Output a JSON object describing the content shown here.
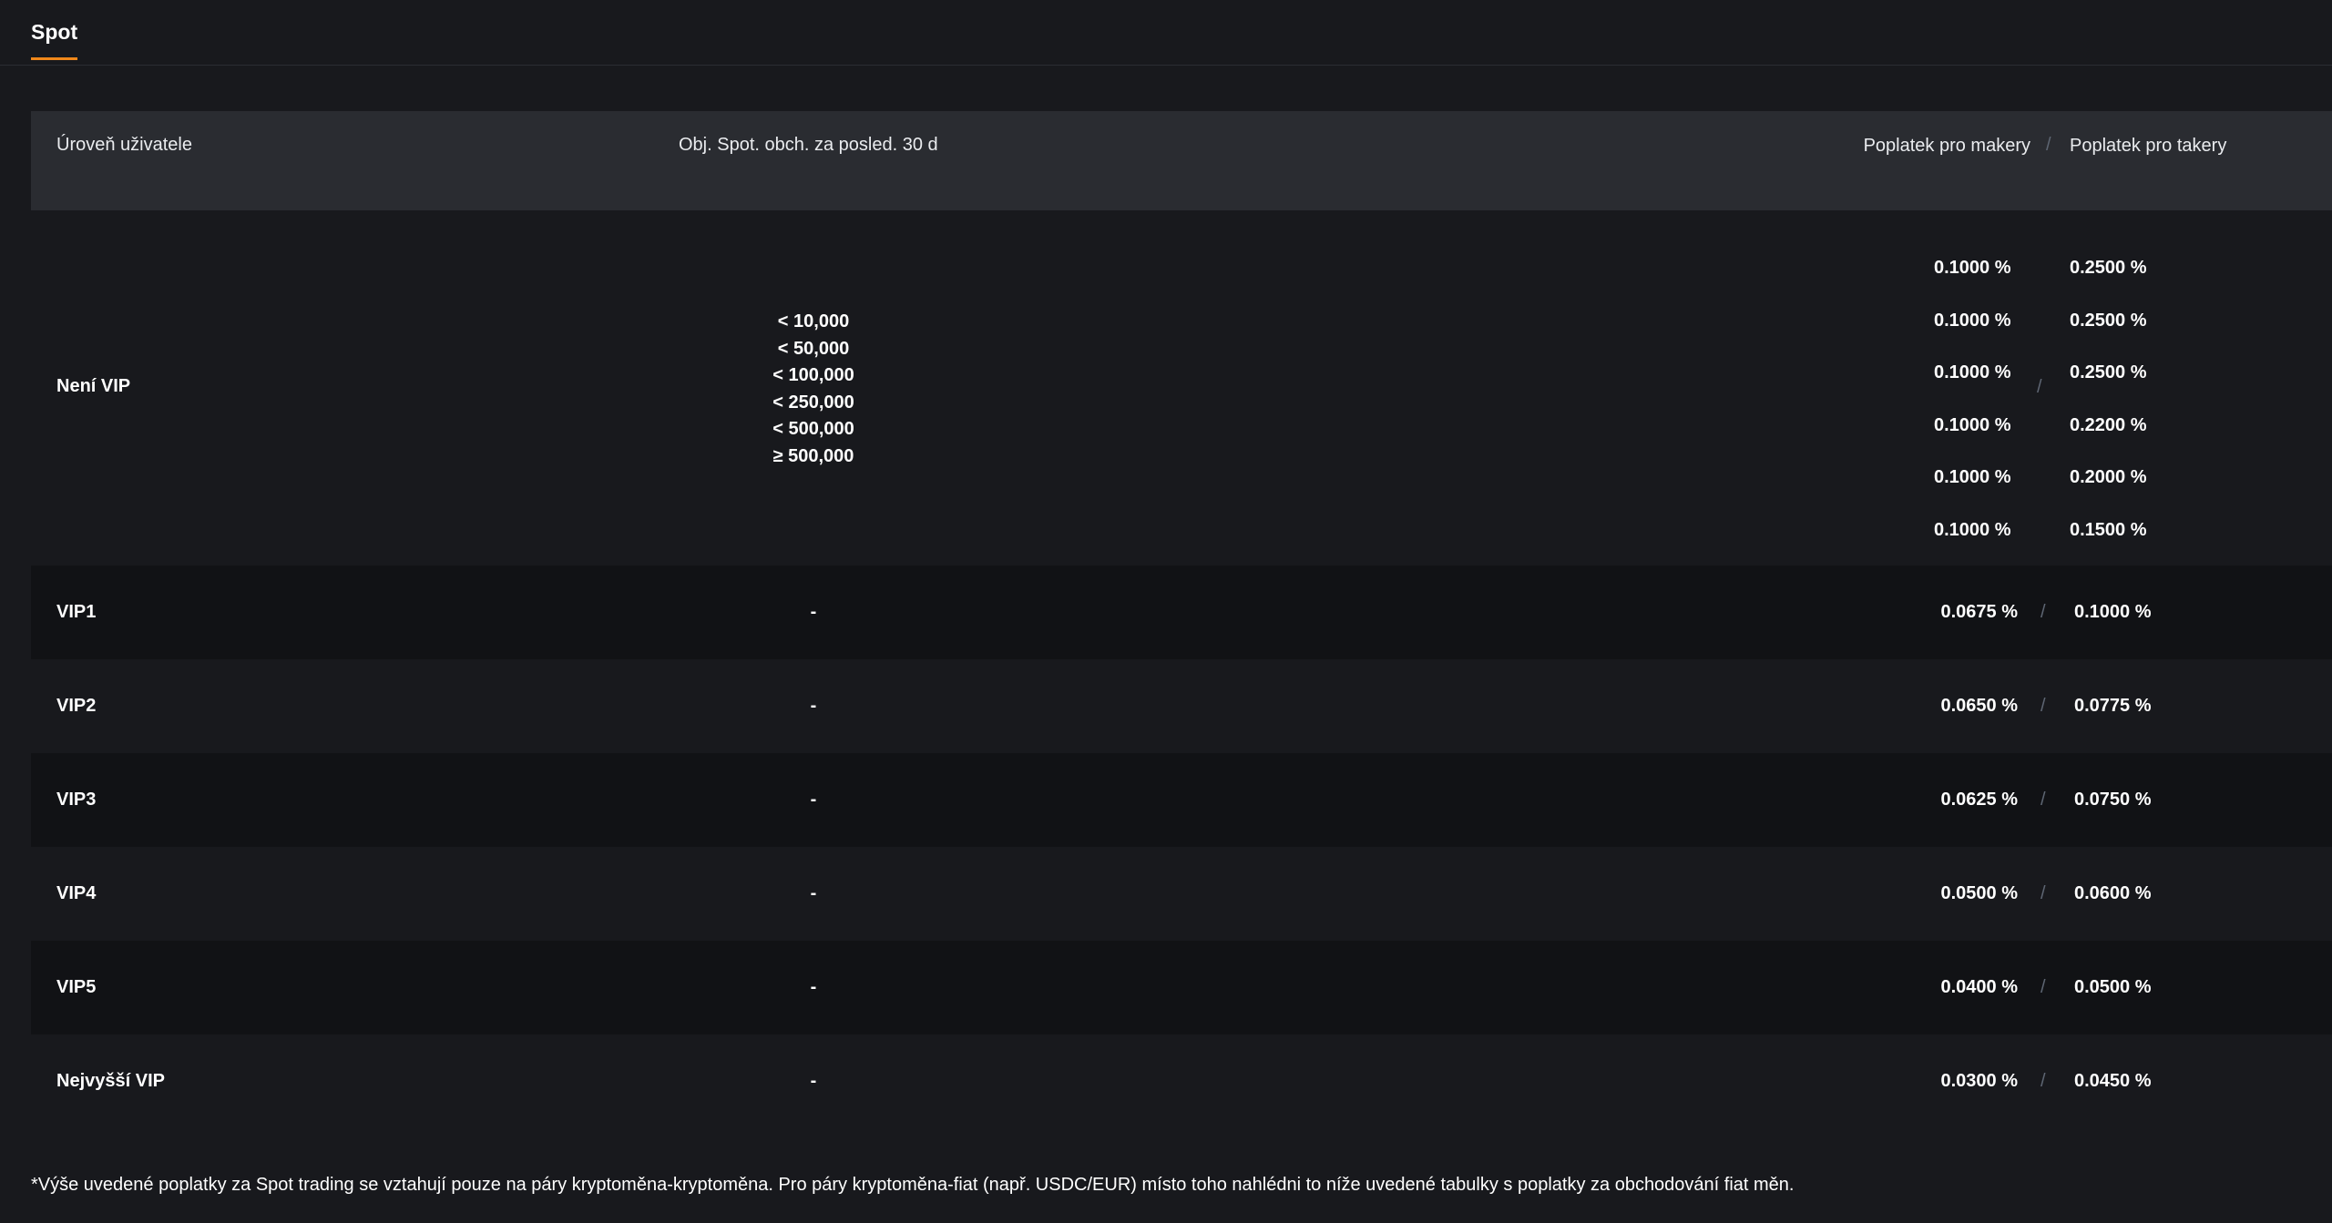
{
  "tabs": [
    {
      "label": "Spot",
      "active": true
    }
  ],
  "table": {
    "headers": {
      "level": "Úroveň uživatele",
      "volume": "Obj. Spot. obch. za posled. 30 d",
      "maker": "Poplatek pro makery",
      "separator": "/",
      "taker": "Poplatek pro takery"
    },
    "non_vip": {
      "level": "Není VIP",
      "volumes": [
        "< 10,000",
        "< 50,000",
        "< 100,000",
        "< 250,000",
        "< 500,000",
        "≥ 500,000"
      ],
      "maker_fees": [
        "0.1000 %",
        "0.1000 %",
        "0.1000 %",
        "0.1000 %",
        "0.1000 %",
        "0.1000 %"
      ],
      "taker_fees": [
        "0.2500 %",
        "0.2500 %",
        "0.2500 %",
        "0.2200 %",
        "0.2000 %",
        "0.1500 %"
      ],
      "separator": "/"
    },
    "rows": [
      {
        "level": "VIP1",
        "volume": "-",
        "maker": "0.0675 %",
        "sep": "/",
        "taker": "0.1000 %"
      },
      {
        "level": "VIP2",
        "volume": "-",
        "maker": "0.0650 %",
        "sep": "/",
        "taker": "0.0775 %"
      },
      {
        "level": "VIP3",
        "volume": "-",
        "maker": "0.0625 %",
        "sep": "/",
        "taker": "0.0750 %"
      },
      {
        "level": "VIP4",
        "volume": "-",
        "maker": "0.0500 %",
        "sep": "/",
        "taker": "0.0600 %"
      },
      {
        "level": "VIP5",
        "volume": "-",
        "maker": "0.0400 %",
        "sep": "/",
        "taker": "0.0500 %"
      },
      {
        "level": "Nejvyšší VIP",
        "volume": "-",
        "maker": "0.0300 %",
        "sep": "/",
        "taker": "0.0450 %"
      }
    ]
  },
  "footnote": "*Výše uvedené poplatky za Spot trading se vztahují pouze na páry kryptoměna-kryptoměna. Pro páry kryptoměna-fiat (např. USDC/EUR) místo toho nahlédni to níže uvedené tabulky s poplatky za obchodování fiat měn.",
  "colors": {
    "background": "#18191d",
    "header_bg": "#2a2c31",
    "alt_row_bg": "#111215",
    "accent": "#f0871a",
    "separator": "#5e6673"
  }
}
